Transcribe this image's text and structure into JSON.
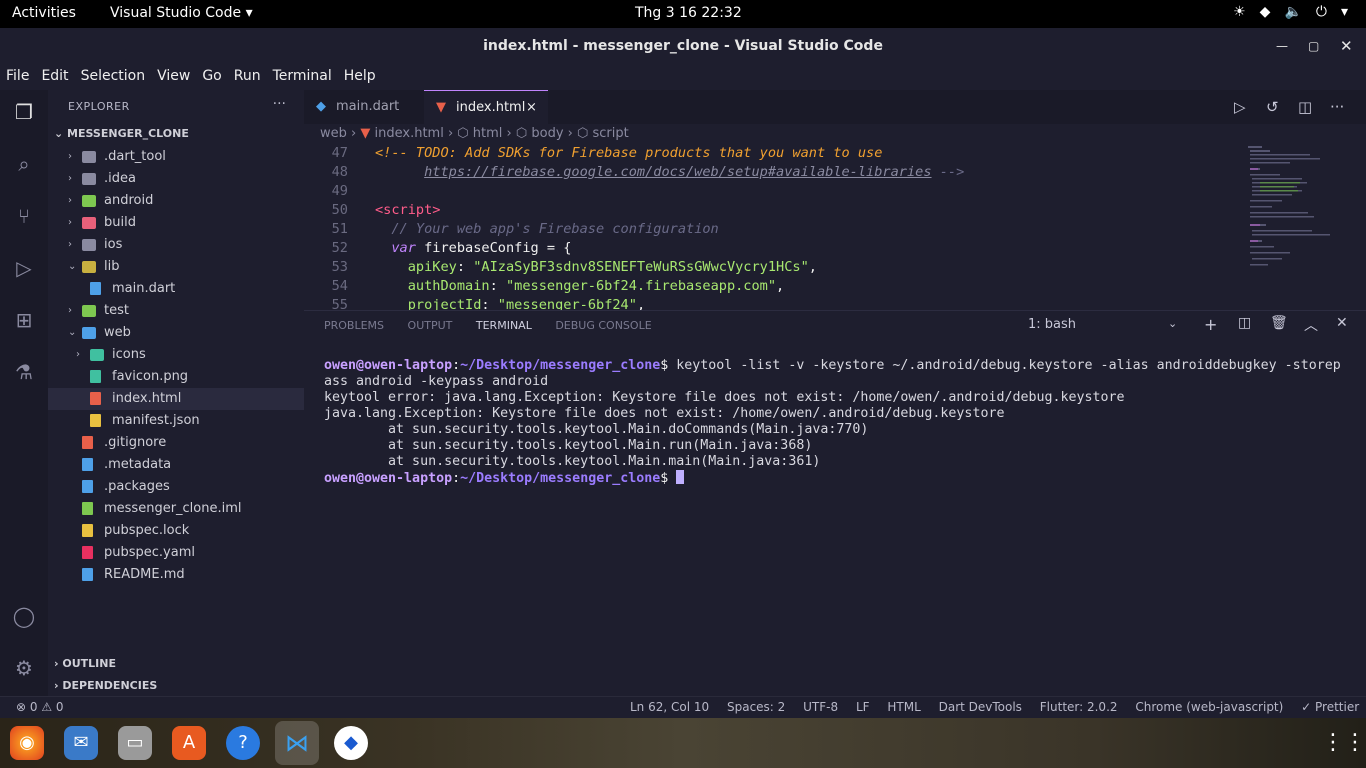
{
  "topbar": {
    "activities": "Activities",
    "app": "Visual Studio Code ▾",
    "clock": "Thg 3 16  22:32"
  },
  "titlebar": {
    "title": "index.html - messenger_clone - Visual Studio Code"
  },
  "menu": [
    "File",
    "Edit",
    "Selection",
    "View",
    "Go",
    "Run",
    "Terminal",
    "Help"
  ],
  "explorer": {
    "header": "EXPLORER",
    "more": "···",
    "root": "MESSENGER_CLONE",
    "items": [
      {
        "label": ".dart_tool",
        "depth": 1,
        "kind": "folder",
        "chev": "›",
        "color": "#8a8aa0"
      },
      {
        "label": ".idea",
        "depth": 1,
        "kind": "folder",
        "chev": "›",
        "color": "#8a8aa0"
      },
      {
        "label": "android",
        "depth": 1,
        "kind": "folder",
        "chev": "›",
        "color": "#7ec850"
      },
      {
        "label": "build",
        "depth": 1,
        "kind": "folder",
        "chev": "›",
        "color": "#e8607a"
      },
      {
        "label": "ios",
        "depth": 1,
        "kind": "folder",
        "chev": "›",
        "color": "#8a8aa0"
      },
      {
        "label": "lib",
        "depth": 1,
        "kind": "folder-open",
        "chev": "⌄",
        "color": "#c8b040"
      },
      {
        "label": "main.dart",
        "depth": 2,
        "kind": "file",
        "chev": "",
        "color": "#4ea0e8"
      },
      {
        "label": "test",
        "depth": 1,
        "kind": "folder",
        "chev": "›",
        "color": "#7ec850"
      },
      {
        "label": "web",
        "depth": 1,
        "kind": "folder-open",
        "chev": "⌄",
        "color": "#4ea0e8"
      },
      {
        "label": "icons",
        "depth": 2,
        "kind": "folder",
        "chev": "›",
        "color": "#40c0a0"
      },
      {
        "label": "favicon.png",
        "depth": 2,
        "kind": "file",
        "chev": "",
        "color": "#40c0a0"
      },
      {
        "label": "index.html",
        "depth": 2,
        "kind": "file",
        "chev": "",
        "color": "#e8604a"
      },
      {
        "label": "manifest.json",
        "depth": 2,
        "kind": "file",
        "chev": "",
        "color": "#e8c040"
      },
      {
        "label": ".gitignore",
        "depth": 1,
        "kind": "file",
        "chev": "",
        "color": "#e8604a"
      },
      {
        "label": ".metadata",
        "depth": 1,
        "kind": "file",
        "chev": "",
        "color": "#4ea0e8"
      },
      {
        "label": ".packages",
        "depth": 1,
        "kind": "file",
        "chev": "",
        "color": "#4ea0e8"
      },
      {
        "label": "messenger_clone.iml",
        "depth": 1,
        "kind": "file",
        "chev": "",
        "color": "#7ec850"
      },
      {
        "label": "pubspec.lock",
        "depth": 1,
        "kind": "file",
        "chev": "",
        "color": "#e8c040"
      },
      {
        "label": "pubspec.yaml",
        "depth": 1,
        "kind": "file",
        "chev": "",
        "color": "#e83060"
      },
      {
        "label": "README.md",
        "depth": 1,
        "kind": "file",
        "chev": "",
        "color": "#4ea0e8"
      }
    ],
    "outline": "OUTLINE",
    "dependencies": "DEPENDENCIES"
  },
  "tabs": [
    {
      "label": "main.dart",
      "active": false
    },
    {
      "label": "index.html",
      "active": true,
      "close": "×"
    }
  ],
  "breadcrumb": [
    "web",
    "index.html",
    "html",
    "body",
    "script"
  ],
  "code": {
    "l47": {
      "n": "47",
      "t": "<!-- TODO: Add SDKs for Firebase products that you want to use"
    },
    "l48": {
      "n": "48",
      "t": "https://firebase.google.com/docs/web/setup#available-libraries",
      "e": " -->"
    },
    "l49": {
      "n": "49"
    },
    "l50": {
      "n": "50",
      "t": "<script>"
    },
    "l51": {
      "n": "51",
      "t": "// Your web app's Firebase configuration"
    },
    "l52": {
      "n": "52",
      "kw": "var",
      "v": " firebaseConfig = {"
    },
    "l53": {
      "n": "53",
      "k": "apiKey",
      "s": "\"AIzaSyBF3sdnv8SENEFTeWuRSsGWwcVycry1HCs\"",
      "e": ","
    },
    "l54": {
      "n": "54",
      "k": "authDomain",
      "s": "\"messenger-6bf24.firebaseapp.com\"",
      "e": ","
    },
    "l55": {
      "n": "55",
      "k": "projectId",
      "s": "\"messenger-6bf24\"",
      "e": ","
    }
  },
  "panel": {
    "tabs": [
      "PROBLEMS",
      "OUTPUT",
      "TERMINAL",
      "DEBUG CONSOLE"
    ],
    "shell": "1: bash",
    "prompt_user": "owen@owen-laptop",
    "prompt_path": "~/Desktop/messenger_clone",
    "cmd1": " keytool -list -v -keystore ~/.android/debug.keystore -alias androiddebugkey -storep",
    "cmd1b": "ass android -keypass android",
    "out1": "keytool error: java.lang.Exception: Keystore file does not exist: /home/owen/.android/debug.keystore",
    "out2": "java.lang.Exception: Keystore file does not exist: /home/owen/.android/debug.keystore",
    "out3": "        at sun.security.tools.keytool.Main.doCommands(Main.java:770)",
    "out4": "        at sun.security.tools.keytool.Main.run(Main.java:368)",
    "out5": "        at sun.security.tools.keytool.Main.main(Main.java:361)"
  },
  "status": {
    "errors": "⊗ 0 ⚠ 0",
    "pos": "Ln 62, Col 10",
    "spaces": "Spaces: 2",
    "enc": "UTF-8",
    "eol": "LF",
    "lang": "HTML",
    "devtools": "Dart DevTools",
    "flutter": "Flutter: 2.0.2",
    "device": "Chrome (web-javascript)",
    "prettier": "✓ Prettier"
  }
}
